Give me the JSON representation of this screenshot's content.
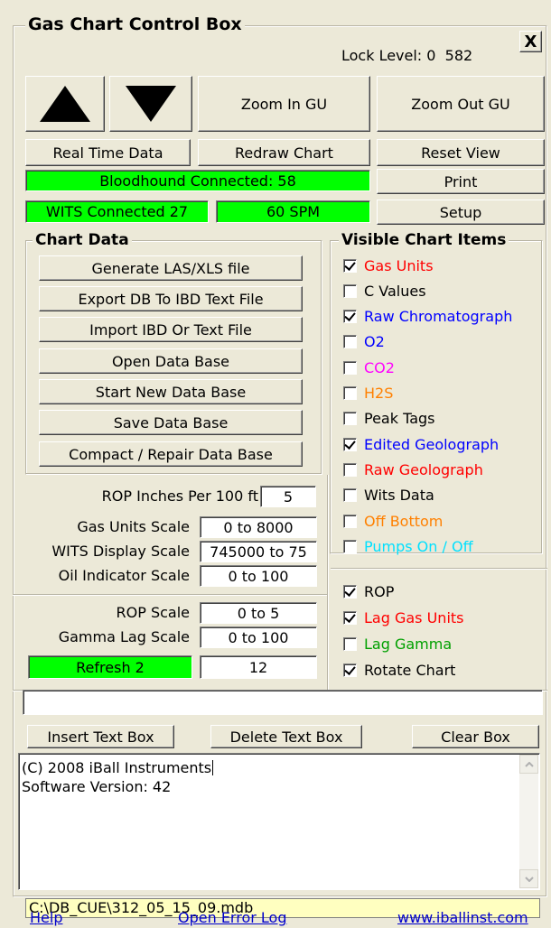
{
  "title": "Gas Chart Control Box",
  "lock_level": "Lock Level: 0  582",
  "close_label": "X",
  "buttons": {
    "zoom_in": "Zoom In GU",
    "zoom_out": "Zoom Out GU",
    "real_time": "Real Time Data",
    "redraw": "Redraw Chart",
    "reset_view": "Reset View",
    "print": "Print",
    "setup": "Setup"
  },
  "status": {
    "bloodhound": "Bloodhound Connected: 58",
    "wits": "WITS Connected 27",
    "spm": "60 SPM",
    "refresh": "Refresh 2",
    "refresh_value": "12"
  },
  "chart_data_group": {
    "title": "Chart Data",
    "buttons": [
      "Generate LAS/XLS file",
      "Export DB To IBD Text File",
      "Import IBD Or Text File",
      "Open Data Base",
      "Start New Data Base",
      "Save Data Base",
      "Compact / Repair Data Base"
    ]
  },
  "scales": [
    {
      "label": "ROP Inches Per 100 ft",
      "value": "5"
    },
    {
      "label": "Gas Units Scale",
      "value": "0 to 8000"
    },
    {
      "label": "WITS Display Scale",
      "value": "745000 to 75"
    },
    {
      "label": "Oil Indicator Scale",
      "value": "0 to 100"
    },
    {
      "label": "ROP Scale",
      "value": "0 to 5"
    },
    {
      "label": "Gamma Lag Scale",
      "value": "0 to 100"
    }
  ],
  "visible_items": {
    "title": "Visible Chart Items",
    "items": [
      {
        "label": "Gas Units",
        "checked": true,
        "color": "#ff0000"
      },
      {
        "label": "C Values",
        "checked": false,
        "color": "#000000"
      },
      {
        "label": "Raw Chromatograph",
        "checked": true,
        "color": "#0000ff"
      },
      {
        "label": "O2",
        "checked": false,
        "color": "#0000ff"
      },
      {
        "label": "CO2",
        "checked": false,
        "color": "#ff00ff"
      },
      {
        "label": "H2S",
        "checked": false,
        "color": "#ff8000"
      },
      {
        "label": "Peak Tags",
        "checked": false,
        "color": "#000000"
      },
      {
        "label": "Edited Geolograph",
        "checked": true,
        "color": "#0000ff"
      },
      {
        "label": "Raw Geolograph",
        "checked": false,
        "color": "#ff0000"
      },
      {
        "label": "Wits Data",
        "checked": false,
        "color": "#000000"
      },
      {
        "label": "Off Bottom",
        "checked": false,
        "color": "#ff8000"
      },
      {
        "label": "Pumps On / Off",
        "checked": false,
        "color": "#00e0ff"
      }
    ],
    "extra": [
      {
        "label": "ROP",
        "checked": true,
        "color": "#000000"
      },
      {
        "label": "Lag Gas Units",
        "checked": true,
        "color": "#ff0000"
      },
      {
        "label": "Lag Gamma",
        "checked": false,
        "color": "#00a000"
      },
      {
        "label": "Rotate Chart",
        "checked": true,
        "color": "#000000"
      }
    ]
  },
  "textbox_buttons": {
    "insert": "Insert Text Box",
    "delete": "Delete Text Box",
    "clear": "Clear Box"
  },
  "memo": {
    "line1": "(C) 2008 iBall Instruments",
    "line2": "Software Version: 42"
  },
  "db_path": "C:\\DB_CUE\\312_05_15_09.mdb",
  "links": {
    "help": "Help",
    "error_log": "Open Error Log",
    "website": "www.iballinst.com"
  }
}
